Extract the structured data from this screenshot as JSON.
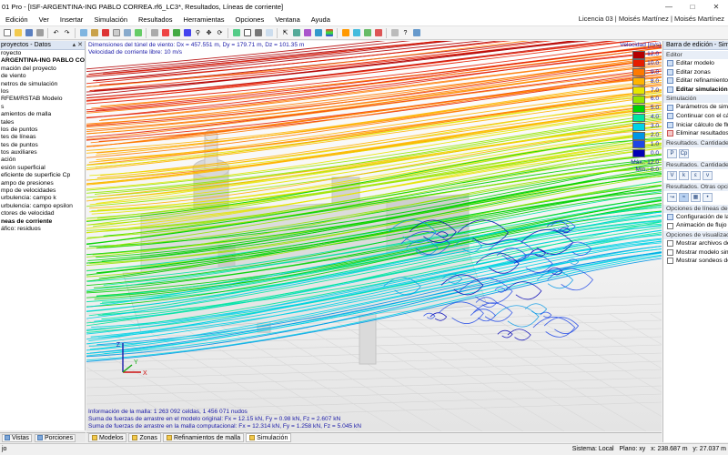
{
  "window": {
    "title": "01 Pro - [ISF-ARGENTINA-ING PABLO CORREA.rf6_LC3*, Resultados, Líneas de corriente]"
  },
  "menu": {
    "items": [
      "Edición",
      "Ver",
      "Insertar",
      "Simulación",
      "Resultados",
      "Herramientas",
      "Opciones",
      "Ventana",
      "Ayuda"
    ],
    "license": "Licencia 03 | Moisés Martínez | Moisés Martínez"
  },
  "navigator": {
    "header": "proyectos - Datos",
    "items": [
      {
        "label": "royecto",
        "bold": false
      },
      {
        "label": "ARGENTINA-ING PABLO CORRE.",
        "bold": true
      },
      {
        "label": "mación del proyecto",
        "bold": false
      },
      {
        "label": "de viento",
        "bold": false
      },
      {
        "label": "netros de simulación",
        "bold": false
      },
      {
        "label": "los",
        "bold": false
      },
      {
        "label": "RFEM/RSTAB Modelo",
        "bold": false
      },
      {
        "label": "s",
        "bold": false
      },
      {
        "label": "amientos de malla",
        "bold": false
      },
      {
        "label": "tales",
        "bold": false
      },
      {
        "label": "los de puntos",
        "bold": false
      },
      {
        "label": "tes de líneas",
        "bold": false
      },
      {
        "label": "tes de puntos",
        "bold": false
      },
      {
        "label": "tos auxiliares",
        "bold": false
      },
      {
        "label": "ación",
        "bold": false
      },
      {
        "label": "esión superficial",
        "bold": false
      },
      {
        "label": "eficiente de superficie Cp",
        "bold": false
      },
      {
        "label": "ampo de presiones",
        "bold": false
      },
      {
        "label": "mpo de velocidades",
        "bold": false
      },
      {
        "label": "urbulencia: campo k",
        "bold": false
      },
      {
        "label": "urbulencia: campo epsilon",
        "bold": false
      },
      {
        "label": "ctores de velocidad",
        "bold": false
      },
      {
        "label": "neas de corriente",
        "bold": true
      },
      {
        "label": "áfico: residuos",
        "bold": false
      }
    ],
    "tabs": [
      "Vistas",
      "Porciones"
    ]
  },
  "viewport": {
    "info_line1": "Dimensiones del túnel de viento: Dx = 457.551 m, Dy = 179.71 m, Dz = 101.35 m",
    "info_line2": "Velocidad de corriente libre: 10 m/s",
    "bottom_line1": "Información de la malla: 1 263 092 celdas, 1 456 071 nudos",
    "bottom_line2": "Suma de fuerzas de arrastre en el modelo original: Fx = 12.15 kN, Fy = 0.98 kN, Fz = 2.607 kN",
    "bottom_line3": "Suma de fuerzas de arrastre en la malla computacional: Fx = 12.314 kN, Fy = 1.258 kN, Fz = 5.045 kN",
    "axes": {
      "x": "X",
      "y": "Y",
      "z": "Z"
    }
  },
  "legend": {
    "title": "Velocidad [m/s]",
    "rows": [
      {
        "value": "12.0",
        "color": "#b40000"
      },
      {
        "value": "10.0",
        "color": "#e61e00"
      },
      {
        "value": "9.0",
        "color": "#ff7a00"
      },
      {
        "value": "8.0",
        "color": "#ffb400"
      },
      {
        "value": "7.0",
        "color": "#e6e600"
      },
      {
        "value": "6.0",
        "color": "#96e600"
      },
      {
        "value": "5.0",
        "color": "#00d200"
      },
      {
        "value": "4.0",
        "color": "#00e6a0"
      },
      {
        "value": "3.0",
        "color": "#00d2e6"
      },
      {
        "value": "2.0",
        "color": "#0096e6"
      },
      {
        "value": "1.0",
        "color": "#1e46e6"
      },
      {
        "value": "0.0",
        "color": "#0000b4"
      }
    ],
    "max_label": "Máx.:",
    "max_value": "12.0",
    "min_label": "Mín.:",
    "min_value": "0.0"
  },
  "view_tabs": [
    "Modelos",
    "Zonas",
    "Refinamientos de malla",
    "Simulación"
  ],
  "edit_panel": {
    "header": "Barra de edición - Simulación",
    "editor_title": "Editor",
    "editor_items": [
      {
        "label": "Editar modelo",
        "bold": false
      },
      {
        "label": "Editar zonas",
        "bold": false
      },
      {
        "label": "Editar refinamientos",
        "bold": false
      },
      {
        "label": "Editar simulación",
        "bold": true
      }
    ],
    "sim_title": "Simulación",
    "sim_items": [
      "Parámetros de simulación",
      "Continuar con el cálculo",
      "Iniciar cálculo de flujo",
      "Eliminar resultados"
    ],
    "res1_title": "Resultados. Cantidades de...",
    "res1_btns": [
      "P",
      "Cp"
    ],
    "res2_title": "Resultados. Cantidades de...",
    "res2_btns": [
      "V",
      "k",
      "ε",
      "ν"
    ],
    "res3_title": "Resultados. Otras opciones",
    "streamline_title": "Opciones de líneas de corriente",
    "streamline_items": [
      "Configuración de las líneas",
      "Animación de flujo"
    ],
    "vis_title": "Opciones de visualización",
    "vis_items": [
      "Mostrar archivos de resultados",
      "Mostrar modelo simplificado",
      "Mostrar sondeos de puntos"
    ]
  },
  "status": {
    "left": "jo",
    "system": "Sistema: Local",
    "plane": "Plano: xy",
    "x": "x: 238.687 m",
    "y": "y: 27.037 m"
  }
}
